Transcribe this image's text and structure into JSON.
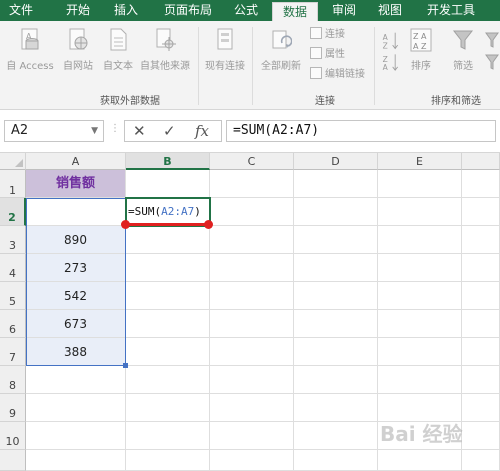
{
  "tabs": [
    {
      "label": "文件"
    },
    {
      "label": "开始"
    },
    {
      "label": "插入"
    },
    {
      "label": "页面布局"
    },
    {
      "label": "公式"
    },
    {
      "label": "数据"
    },
    {
      "label": "审阅"
    },
    {
      "label": "视图"
    },
    {
      "label": "开发工具"
    }
  ],
  "ribbon": {
    "external": {
      "buttons": [
        {
          "label": "自 Access",
          "icon": "access-db-icon"
        },
        {
          "label": "自网站",
          "icon": "web-icon"
        },
        {
          "label": "自文本",
          "icon": "text-file-icon"
        },
        {
          "label": "自其他来源",
          "icon": "other-sources-icon"
        },
        {
          "label": "现有连接",
          "icon": "existing-connections-icon"
        }
      ],
      "group_label": "获取外部数据"
    },
    "connections": {
      "refresh_label": "全部刷新",
      "items": [
        "连接",
        "属性",
        "编辑链接"
      ],
      "group_label": "连接"
    },
    "sort": {
      "sort_label": "排序",
      "filter_label": "筛选",
      "group_label": "排序和筛选"
    }
  },
  "formula_bar": {
    "name_box": "A2",
    "cancel_icon": "✕",
    "enter_icon": "✓",
    "fx_icon": "fx",
    "formula": "=SUM(A2:A7)"
  },
  "sheet": {
    "columns": [
      "A",
      "B",
      "C",
      "D",
      "E"
    ],
    "rows": [
      "1",
      "2",
      "3",
      "4",
      "5",
      "6",
      "7",
      "8",
      "9",
      "10"
    ],
    "a1_header": "销售额",
    "b2_formula_prefix": "=SUM(",
    "b2_formula_ref": "A2:A7",
    "b2_formula_suffix": ")",
    "values": [
      "890",
      "273",
      "542",
      "673",
      "388"
    ]
  },
  "watermark": "Bai 经验",
  "colors": {
    "accent": "#217346",
    "header_fill": "#ccc0da",
    "header_text": "#7030a0",
    "range_border": "#4472c4",
    "marker": "#e02020"
  }
}
